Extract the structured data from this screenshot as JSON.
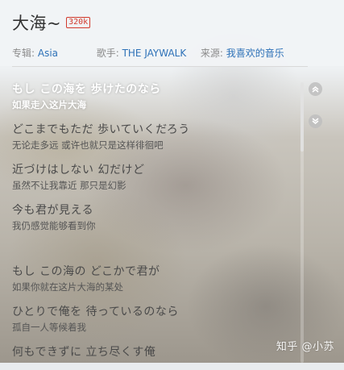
{
  "song": {
    "title": "大海~",
    "quality_badge": "320k"
  },
  "meta": {
    "album_label": "专辑:",
    "album": "Asia",
    "singer_label": "歌手:",
    "singer": "THE JAYWALK",
    "source_label": "来源:",
    "source": "我喜欢的音乐"
  },
  "lyrics": [
    {
      "jp": "もし この海を 歩けたのなら",
      "cn": "如果走入这片大海",
      "current": true
    },
    {
      "jp": "どこまでもただ 歩いていくだろう",
      "cn": "无论走多远 或许也就只是这样徘徊吧"
    },
    {
      "jp": "近づけはしない 幻だけど",
      "cn": "虽然不让我靠近 那只是幻影"
    },
    {
      "jp": "今も君が見える",
      "cn": "我仍感觉能够看到你"
    },
    {
      "jp": "もし この海の どこかで君が",
      "cn": "如果你就在这片大海的某处"
    },
    {
      "jp": "ひとりで俺を 待っているのなら",
      "cn": "孤自一人等候着我"
    },
    {
      "jp": "何もできずに 立ち尽くす俺",
      "cn": ""
    }
  ],
  "icons": {
    "scroll_up": "chevron-up-circle-icon",
    "scroll_down": "chevron-down-circle-icon"
  },
  "watermark": "知乎 @小苏"
}
